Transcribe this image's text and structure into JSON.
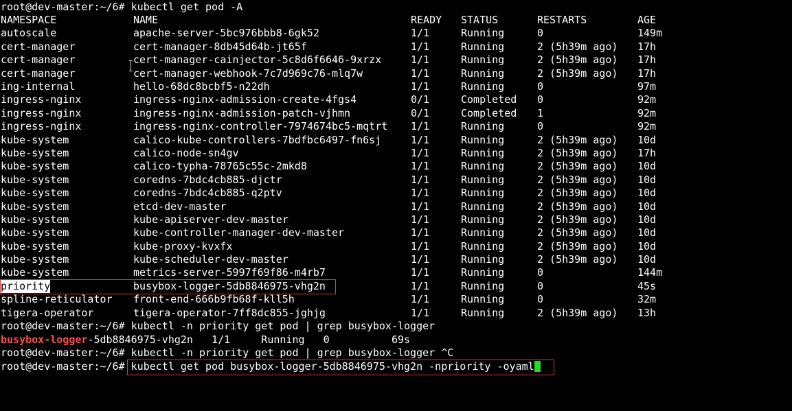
{
  "terminal": {
    "prompt": "root@dev-master:~/6#",
    "commands": {
      "get_all": "kubectl get pod -A",
      "grep": "kubectl -n priority get pod | grep busybox-logger",
      "grep_interrupted": "kubectl -n priority get pod | grep busybox-logger ^C",
      "get_yaml": "kubectl get pod busybox-logger-5db8846975-vhg2n -npriority -oyaml"
    },
    "table": {
      "headers": {
        "namespace": "NAMESPACE",
        "name": "NAME",
        "ready": "READY",
        "status": "STATUS",
        "restarts": "RESTARTS",
        "age": "AGE"
      },
      "rows": [
        {
          "namespace": "autoscale",
          "name": "apache-server-5bc976bbb8-6gk52",
          "ready": "1/1",
          "status": "Running",
          "restarts": "0",
          "age": "149m"
        },
        {
          "namespace": "cert-manager",
          "name": "cert-manager-8db45d64b-jt65f",
          "ready": "1/1",
          "status": "Running",
          "restarts": "2 (5h39m ago)",
          "age": "17h"
        },
        {
          "namespace": "cert-manager",
          "name": "cert-manager-cainjector-5c8d6f6646-9xrzx",
          "ready": "1/1",
          "status": "Running",
          "restarts": "2 (5h39m ago)",
          "age": "17h"
        },
        {
          "namespace": "cert-manager",
          "name": "cert-manager-webhook-7c7d969c76-mlq7w",
          "ready": "1/1",
          "status": "Running",
          "restarts": "2 (5h39m ago)",
          "age": "17h"
        },
        {
          "namespace": "ing-internal",
          "name": "hello-68dc8bcbf5-n22dh",
          "ready": "1/1",
          "status": "Running",
          "restarts": "0",
          "age": "97m"
        },
        {
          "namespace": "ingress-nginx",
          "name": "ingress-nginx-admission-create-4fgs4",
          "ready": "0/1",
          "status": "Completed",
          "restarts": "0",
          "age": "92m"
        },
        {
          "namespace": "ingress-nginx",
          "name": "ingress-nginx-admission-patch-vjhmn",
          "ready": "0/1",
          "status": "Completed",
          "restarts": "1",
          "age": "92m"
        },
        {
          "namespace": "ingress-nginx",
          "name": "ingress-nginx-controller-7974674bc5-mqtrt",
          "ready": "1/1",
          "status": "Running",
          "restarts": "0",
          "age": "92m"
        },
        {
          "namespace": "kube-system",
          "name": "calico-kube-controllers-7bdfbc6497-fn6sj",
          "ready": "1/1",
          "status": "Running",
          "restarts": "2 (5h39m ago)",
          "age": "10d"
        },
        {
          "namespace": "kube-system",
          "name": "calico-node-sn4gv",
          "ready": "1/1",
          "status": "Running",
          "restarts": "2 (5h39m ago)",
          "age": "17h"
        },
        {
          "namespace": "kube-system",
          "name": "calico-typha-78765c55c-2mkd8",
          "ready": "1/1",
          "status": "Running",
          "restarts": "2 (5h39m ago)",
          "age": "10d"
        },
        {
          "namespace": "kube-system",
          "name": "coredns-7bdc4cb885-djctr",
          "ready": "1/1",
          "status": "Running",
          "restarts": "2 (5h39m ago)",
          "age": "10d"
        },
        {
          "namespace": "kube-system",
          "name": "coredns-7bdc4cb885-q2ptv",
          "ready": "1/1",
          "status": "Running",
          "restarts": "2 (5h39m ago)",
          "age": "10d"
        },
        {
          "namespace": "kube-system",
          "name": "etcd-dev-master",
          "ready": "1/1",
          "status": "Running",
          "restarts": "2 (5h39m ago)",
          "age": "10d"
        },
        {
          "namespace": "kube-system",
          "name": "kube-apiserver-dev-master",
          "ready": "1/1",
          "status": "Running",
          "restarts": "2 (5h39m ago)",
          "age": "10d"
        },
        {
          "namespace": "kube-system",
          "name": "kube-controller-manager-dev-master",
          "ready": "1/1",
          "status": "Running",
          "restarts": "2 (5h39m ago)",
          "age": "10d"
        },
        {
          "namespace": "kube-system",
          "name": "kube-proxy-kvxfx",
          "ready": "1/1",
          "status": "Running",
          "restarts": "2 (5h39m ago)",
          "age": "10d"
        },
        {
          "namespace": "kube-system",
          "name": "kube-scheduler-dev-master",
          "ready": "1/1",
          "status": "Running",
          "restarts": "2 (5h39m ago)",
          "age": "10d"
        },
        {
          "namespace": "kube-system",
          "name": "metrics-server-5997f69f86-m4rb7",
          "ready": "1/1",
          "status": "Running",
          "restarts": "0",
          "age": "144m"
        },
        {
          "namespace": "priority",
          "name": "busybox-logger-5db8846975-vhg2n",
          "ready": "1/1",
          "status": "Running",
          "restarts": "0",
          "age": "45s"
        },
        {
          "namespace": "spline-reticulator",
          "name": "front-end-666b9fb68f-kll5h",
          "ready": "1/1",
          "status": "Running",
          "restarts": "0",
          "age": "32m"
        },
        {
          "namespace": "tigera-operator",
          "name": "tigera-operator-7ff8dc855-jghjg",
          "ready": "1/1",
          "status": "Running",
          "restarts": "2 (5h39m ago)",
          "age": "13h"
        }
      ]
    },
    "grep_result": {
      "match": "busybox-logger",
      "rest": "-5db8846975-vhg2n   1/1     Running   0          69s"
    },
    "colors": {
      "background": "#000000",
      "text": "#ffffff",
      "grep_match": "#ff4d4d",
      "highlight_box": "#e03b3b",
      "cursor": "#22dd22"
    }
  }
}
